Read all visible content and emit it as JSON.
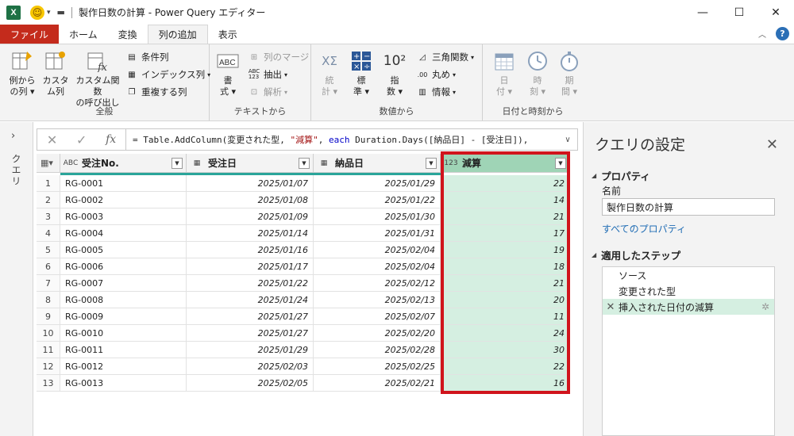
{
  "window": {
    "title": "製作日数の計算 - Power Query エディター",
    "app_icon_label": "X"
  },
  "ribbon_tabs": [
    "ファイル",
    "ホーム",
    "変換",
    "列の追加",
    "表示"
  ],
  "active_tab": "列の追加",
  "ribbon": {
    "general": {
      "label": "全般",
      "example_col": "例から\nの列 ▾",
      "custom_col": "カスタ\nム列",
      "custom_func": "カスタム関数\nの呼び出し",
      "conditional_col": "条件列",
      "index_col": "インデックス列",
      "duplicate_col": "重複する列"
    },
    "text": {
      "label": "テキストから",
      "format": "書\n式 ▾",
      "merge_cols": "列のマージ",
      "extract": "抽出",
      "parse": "解析"
    },
    "number": {
      "label": "数値から",
      "statistics": "統\n計 ▾",
      "standard": "標\n準 ▾",
      "scientific": "指\n数 ▾",
      "scientific_icon_text": "10²",
      "trigonometry": "三角関数",
      "rounding": "丸め",
      "information": "情報"
    },
    "datetime": {
      "label": "日付と時刻から",
      "date": "日\n付 ▾",
      "time": "時\n刻 ▾",
      "duration": "期\n間 ▾"
    }
  },
  "query_pane_label": "クエリ",
  "formula_bar": {
    "prefix": "= Table.AddColumn(変更された型, ",
    "string": "\"減算\"",
    "sep": ", ",
    "keyword": "each",
    "rest": " Duration.Days([納品日] - [受注日]),"
  },
  "columns": [
    {
      "name": "受注No.",
      "type_icon": "ABC"
    },
    {
      "name": "受注日",
      "type_icon": "calendar"
    },
    {
      "name": "納品日",
      "type_icon": "calendar"
    },
    {
      "name": "減算",
      "type_icon": "123"
    }
  ],
  "rows": [
    [
      "1",
      "RG-0001",
      "2025/01/07",
      "2025/01/29",
      "22"
    ],
    [
      "2",
      "RG-0002",
      "2025/01/08",
      "2025/01/22",
      "14"
    ],
    [
      "3",
      "RG-0003",
      "2025/01/09",
      "2025/01/30",
      "21"
    ],
    [
      "4",
      "RG-0004",
      "2025/01/14",
      "2025/01/31",
      "17"
    ],
    [
      "5",
      "RG-0005",
      "2025/01/16",
      "2025/02/04",
      "19"
    ],
    [
      "6",
      "RG-0006",
      "2025/01/17",
      "2025/02/04",
      "18"
    ],
    [
      "7",
      "RG-0007",
      "2025/01/22",
      "2025/02/12",
      "21"
    ],
    [
      "8",
      "RG-0008",
      "2025/01/24",
      "2025/02/13",
      "20"
    ],
    [
      "9",
      "RG-0009",
      "2025/01/27",
      "2025/02/07",
      "11"
    ],
    [
      "10",
      "RG-0010",
      "2025/01/27",
      "2025/02/20",
      "24"
    ],
    [
      "11",
      "RG-0011",
      "2025/01/29",
      "2025/02/28",
      "30"
    ],
    [
      "12",
      "RG-0012",
      "2025/02/03",
      "2025/02/25",
      "22"
    ],
    [
      "13",
      "RG-0013",
      "2025/02/05",
      "2025/02/21",
      "16"
    ]
  ],
  "settings": {
    "title": "クエリの設定",
    "properties_header": "プロパティ",
    "name_label": "名前",
    "name_value": "製作日数の計算",
    "all_properties": "すべてのプロパティ",
    "steps_header": "適用したステップ",
    "steps": [
      "ソース",
      "変更された型",
      "挿入された日付の減算"
    ],
    "active_step": 2
  },
  "colors": {
    "file_tab": "#c42b1c",
    "selected_col": "#d5efe1",
    "highlight_border": "#d0141c",
    "link": "#1f6cb4"
  }
}
